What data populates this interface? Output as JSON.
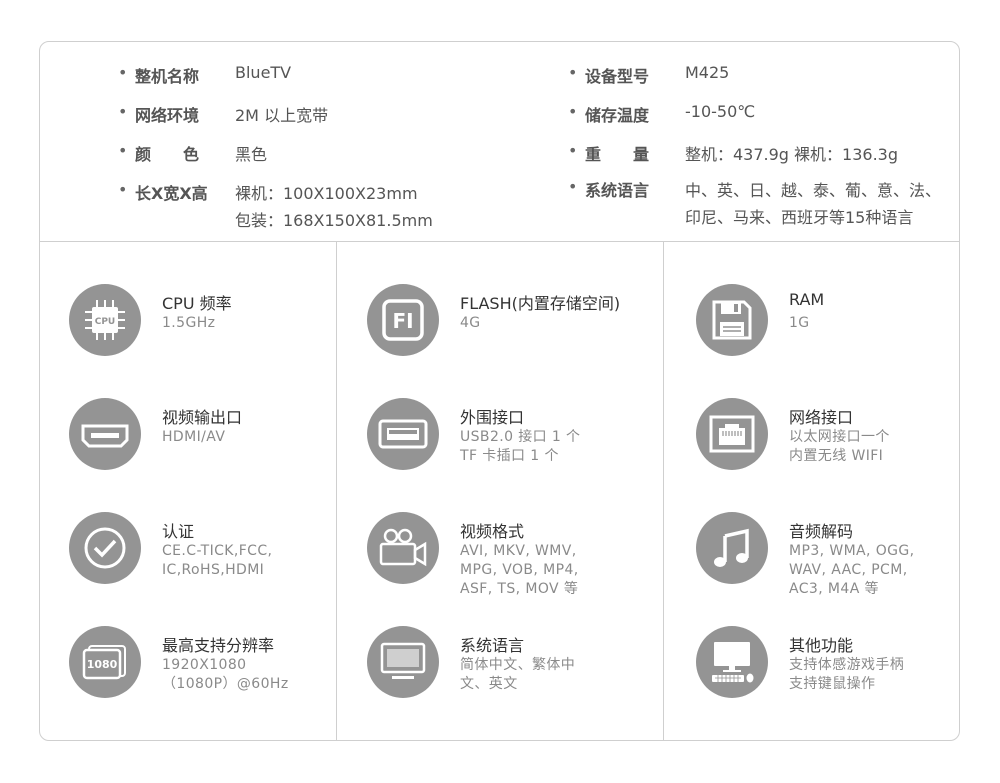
{
  "specs": {
    "left": [
      {
        "label": "整机名称",
        "value": "BlueTV"
      },
      {
        "label": "网络环境",
        "value": "2M 以上宽带"
      },
      {
        "label": "颜　　色",
        "value": "黑色"
      },
      {
        "label": "长X宽X高",
        "value": "裸机：100X100X23mm",
        "value2": "包装：168X150X81.5mm"
      }
    ],
    "right": [
      {
        "label": "设备型号",
        "value": "M425"
      },
      {
        "label": "储存温度",
        "value": "-10-50℃"
      },
      {
        "label": "重　　量",
        "value": "整机：437.9g  裸机：136.3g"
      },
      {
        "label": "系统语言",
        "value": "中、英、日、越、泰、葡、意、法、",
        "value2": "印尼、马来、西班牙等15种语言"
      }
    ]
  },
  "features": {
    "col1": [
      {
        "icon": "cpu-icon",
        "icon_text": "CPU",
        "title": "CPU 频率",
        "desc": "1.5GHz"
      },
      {
        "icon": "hdmi-port-icon",
        "title": "视频输出口",
        "desc": "HDMI/AV"
      },
      {
        "icon": "checkmark-icon",
        "title": "认证",
        "desc": "CE.C-TICK,FCC,\nIC,RoHS,HDMI"
      },
      {
        "icon": "resolution-1080-icon",
        "icon_text": "1080",
        "title": "最高支持分辨率",
        "desc": "1920X1080\n（1080P）@60Hz"
      }
    ],
    "col2": [
      {
        "icon": "flash-icon",
        "icon_text": "FI",
        "title": "FLASH(内置存储空间)",
        "desc": "4G"
      },
      {
        "icon": "usb-port-icon",
        "title": "外围接口",
        "desc": "USB2.0 接口 1 个\nTF 卡插口 1 个"
      },
      {
        "icon": "video-camera-icon",
        "title": "视频格式",
        "desc": "AVI, MKV, WMV,\nMPG, VOB, MP4,\nASF, TS, MOV 等"
      },
      {
        "icon": "monitor-icon",
        "title": "系统语言",
        "desc": "简体中文、繁体中\n文、英文"
      }
    ],
    "col3": [
      {
        "icon": "floppy-disk-icon",
        "title": "RAM",
        "desc": "1G"
      },
      {
        "icon": "ethernet-port-icon",
        "title": "网络接口",
        "desc": "以太网接口一个\n内置无线 WIFI"
      },
      {
        "icon": "music-note-icon",
        "title": "音频解码",
        "desc": "MP3, WMA, OGG,\nWAV, AAC, PCM,\nAC3, M4A 等"
      },
      {
        "icon": "computer-keyboard-mouse-icon",
        "title": "其他功能",
        "desc": "支持体感游戏手柄\n支持键鼠操作"
      }
    ]
  },
  "colors": {
    "icon_bg": "#949494",
    "border": "#cfcfcf"
  }
}
